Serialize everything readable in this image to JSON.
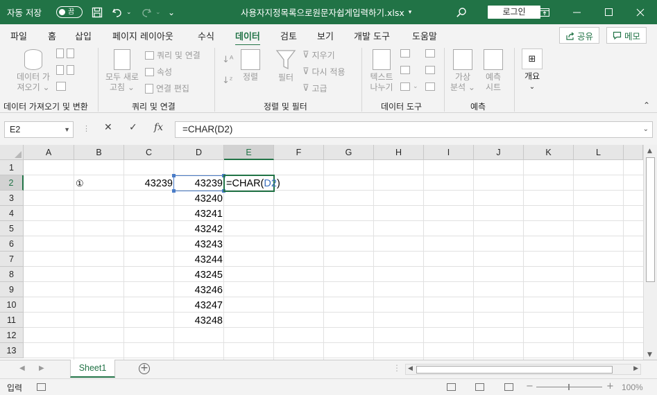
{
  "titlebar": {
    "autosave_label": "자동 저장",
    "autosave_state": "끔",
    "filename": "사용자지정목록으로원문자쉽게입력하기.xlsx",
    "login_label": "로그인",
    "bg_color": "#217346"
  },
  "ribbon_tabs": [
    "파일",
    "홈",
    "삽입",
    "페이지 레이아웃",
    "수식",
    "데이터",
    "검토",
    "보기",
    "개발 도구",
    "도움말"
  ],
  "active_tab": "데이터",
  "share_label": "공유",
  "memo_label": "메모",
  "ribbon": {
    "get_data_line1": "데이터 가",
    "get_data_line2": "져오기",
    "group_get_transform": "데이터 가져오기 및 변환",
    "refresh_line1": "모두 새로",
    "refresh_line2": "고침",
    "queries_connections": "쿼리 및 연결",
    "properties": "속성",
    "edit_links": "연결 편집",
    "group_queries": "쿼리 및 연결",
    "sort": "정렬",
    "filter": "필터",
    "clear": "지우기",
    "reapply": "다시 적용",
    "advanced": "고급",
    "group_sort_filter": "정렬 및 필터",
    "text_to_columns_line1": "텍스트",
    "text_to_columns_line2": "나누기",
    "group_data_tools": "데이터 도구",
    "whatif_line1": "가상",
    "whatif_line2": "분석",
    "forecast_line1": "예측",
    "forecast_line2": "시트",
    "group_forecast": "예측",
    "outline": "개요"
  },
  "formula_bar": {
    "name_box": "E2",
    "cancel_icon": "✕",
    "enter_icon": "✓",
    "fx_label": "fx",
    "formula": "=CHAR(D2)"
  },
  "columns": [
    "A",
    "B",
    "C",
    "D",
    "E",
    "F",
    "G",
    "H",
    "I",
    "J",
    "K",
    "L"
  ],
  "rows": [
    "1",
    "2",
    "3",
    "4",
    "5",
    "6",
    "7",
    "8",
    "9",
    "10",
    "11",
    "12",
    "13"
  ],
  "cells": {
    "B2": "①",
    "C2": "43239",
    "D2": "43239",
    "D3": "43240",
    "D4": "43241",
    "D5": "43242",
    "D6": "43243",
    "D7": "43244",
    "D8": "43245",
    "D9": "43246",
    "D10": "43247",
    "D11": "43248",
    "E2_prefix": "=CHAR(",
    "E2_ref": "D2",
    "E2_suffix": ")"
  },
  "sheet_tab": "Sheet1",
  "status": {
    "mode": "입력",
    "zoom": "100%"
  }
}
